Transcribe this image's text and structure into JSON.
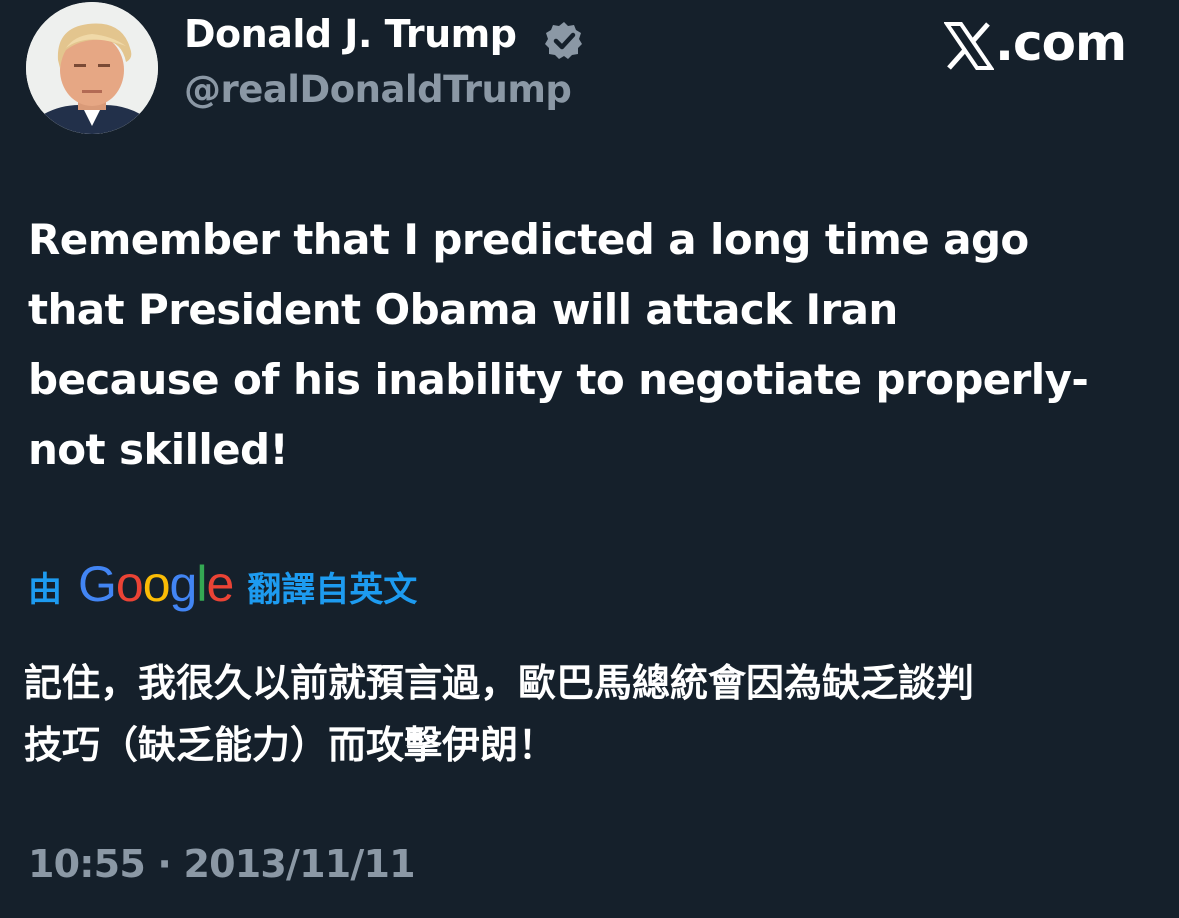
{
  "author": {
    "display_name": "Donald J. Trump",
    "handle": "@realDonaldTrump",
    "verified_icon": "verified-badge-icon",
    "avatar_icon": "profile-avatar"
  },
  "brand": {
    "logo_icon": "x-logo-icon",
    "site_suffix": ".com"
  },
  "tweet": {
    "lines": [
      "Remember that I predicted a long time ago",
      "that President Obama will attack Iran",
      "because of his inability to negotiate properly-",
      "not skilled!"
    ]
  },
  "translation": {
    "prefix": "由",
    "provider_letters": [
      "G",
      "o",
      "o",
      "g",
      "l",
      "e"
    ],
    "provider_colors": [
      "#4285f4",
      "#ea4335",
      "#fbbc05",
      "#4285f4",
      "#34a853",
      "#ea4335"
    ],
    "suffix": "翻譯自英文",
    "lines": [
      "記住，我很久以前就預言過，歐巴馬總統會因為缺乏談判",
      "技巧（缺乏能力）而攻擊伊朗！"
    ]
  },
  "timestamp": "10:55 · 2013/11/11",
  "colors": {
    "background": "#15202b",
    "primary_text": "#ffffff",
    "secondary_text": "#8b98a5",
    "accent": "#1d9bf0"
  }
}
